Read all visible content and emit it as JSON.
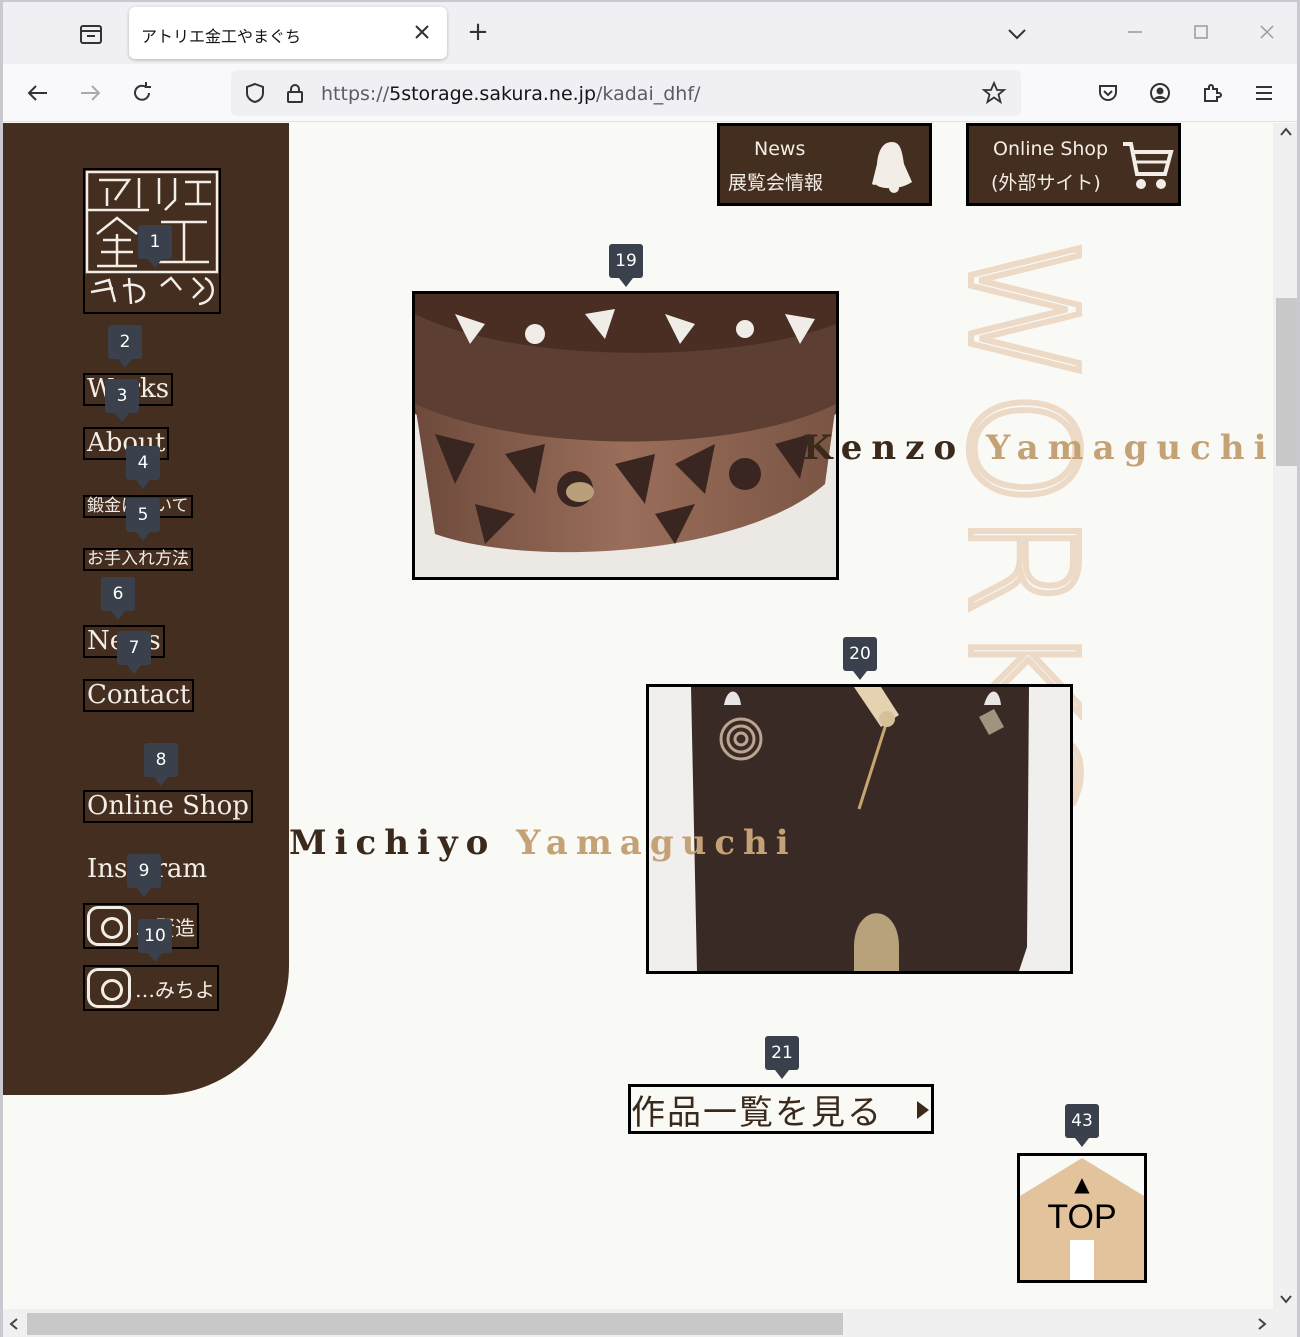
{
  "browser": {
    "tab_title": "アトリエ金工やまぐち",
    "url_scheme": "https://",
    "url_host": "5storage.sakura.ne.jp",
    "url_path": "/kadai_dhf/"
  },
  "sidebar": {
    "logo_text": "アトリエ金工やまぐち",
    "items": [
      {
        "label": "Works"
      },
      {
        "label": "About"
      },
      {
        "label": "鍛金について"
      },
      {
        "label": "お手入れ方法"
      },
      {
        "label": "News"
      },
      {
        "label": "Contact"
      },
      {
        "label": "Online Shop"
      }
    ],
    "instagram_label": "Instgram",
    "instagram_accounts": [
      {
        "label": "…賢造"
      },
      {
        "label": "…みちよ"
      }
    ]
  },
  "header_buttons": {
    "news_line1": "News",
    "news_line2": "展覧会情報",
    "shop_line1": "Online Shop",
    "shop_line2": "(外部サイト)"
  },
  "works": {
    "bg_heading": "WORKS",
    "artist1_first": "Kenzo",
    "artist1_last": "Yamaguchi",
    "artist2_first": "Michiyo",
    "artist2_last": "Yamaguchi",
    "view_all": "作品一覧を見る",
    "top_label": "TOP",
    "top_arrow": "▲"
  },
  "markers": [
    "1",
    "2",
    "3",
    "4",
    "5",
    "6",
    "7",
    "8",
    "9",
    "10",
    "19",
    "20",
    "21",
    "43"
  ],
  "colors": {
    "sidebar_bg": "#432e20",
    "accent_gold": "#c5a276",
    "works_watermark": "#ecd9c6",
    "top_house": "#e2c39b",
    "marker_bg": "#3a414c"
  }
}
